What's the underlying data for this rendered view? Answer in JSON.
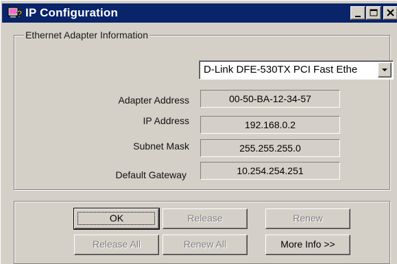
{
  "window": {
    "title": "IP Configuration",
    "title_icon": "ip-config-app-icon",
    "controls": [
      "minimize",
      "maximize",
      "close"
    ],
    "titlebar_color": "#0a246a"
  },
  "adapter_group": {
    "legend": "Ethernet  Adapter Information",
    "adapter_select": "D-Link DFE-530TX PCI Fast Ethe",
    "fields": [
      {
        "label": "Adapter Address",
        "value": "00-50-BA-12-34-57"
      },
      {
        "label": "IP Address",
        "value": "192.168.0.2"
      },
      {
        "label": "Subnet Mask",
        "value": "255.255.255.0"
      },
      {
        "label": "Default Gateway",
        "value": "10.254.254.251"
      }
    ]
  },
  "buttons": {
    "ok": "OK",
    "release": "Release",
    "renew": "Renew",
    "release_all": "Release All",
    "renew_all": "Renew All",
    "more_info": "More Info >>"
  }
}
